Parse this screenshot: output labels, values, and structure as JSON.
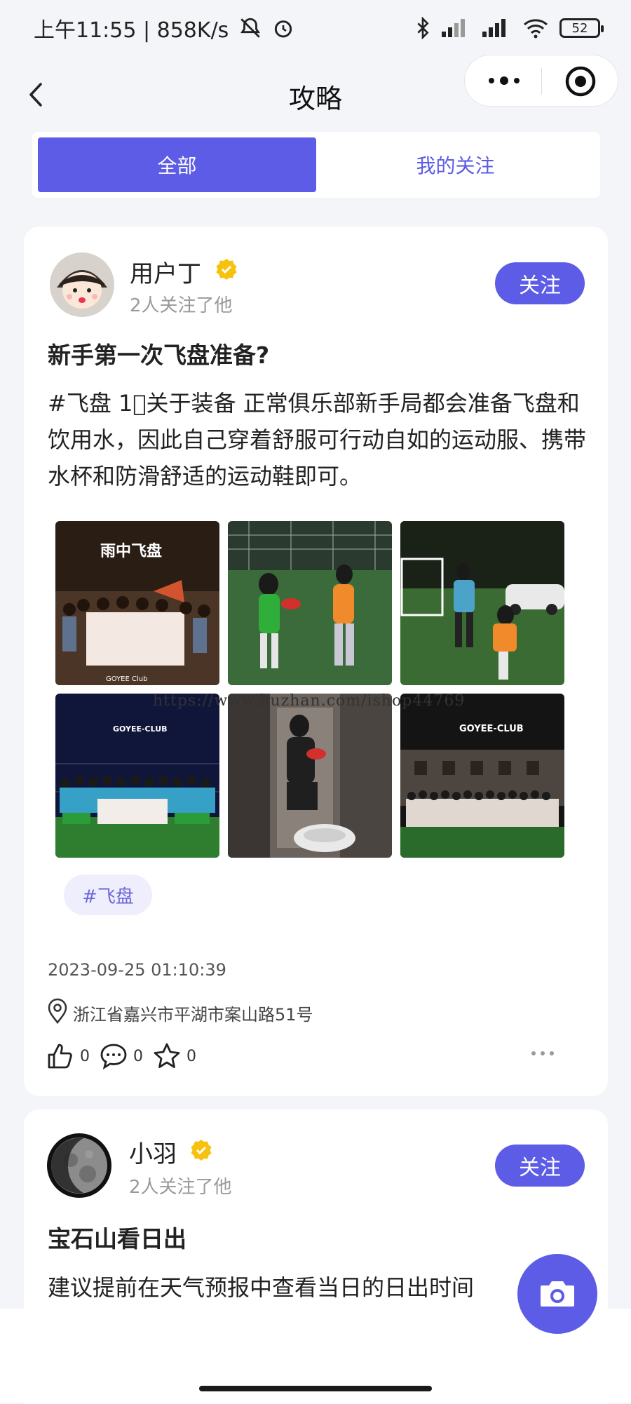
{
  "status_bar": {
    "time": "上午11:55 | 858K/s",
    "battery": "52"
  },
  "nav": {
    "title": "攻略"
  },
  "tabs": [
    {
      "label": "全部",
      "active": true
    },
    {
      "label": "我的关注",
      "active": false
    }
  ],
  "posts": [
    {
      "username": "用户丁",
      "followers_text": "2人关注了他",
      "follow_label": "关注",
      "title": "新手第一次飞盘准备?",
      "body": "#飞盘 1⃣关于装备 正常俱乐部新手局都会准备飞盘和饮用水，因此自己穿着舒服可行动自如的运动服、携带水杯和防滑舒适的运动鞋即可。",
      "photo_captions": [
        "雨中飞盘",
        "GOYEE Club",
        "GOYEE-CLUB",
        "GOYEE-CLUB"
      ],
      "tag": "#飞盘",
      "timestamp": "2023-09-25 01:10:39",
      "location": "浙江省嘉兴市平湖市案山路51号",
      "likes": "0",
      "comments": "0",
      "favorites": "0"
    },
    {
      "username": "小羽",
      "followers_text": "2人关注了他",
      "follow_label": "关注",
      "title": "宝石山看日出",
      "body": "建议提前在天气预报中查看当日的日出时间"
    }
  ],
  "watermark": "https://www.huzhan.com/ishop44769",
  "colors": {
    "accent": "#5c5ce6",
    "verified": "#f6c20e",
    "tag_bg": "#efeefc"
  }
}
